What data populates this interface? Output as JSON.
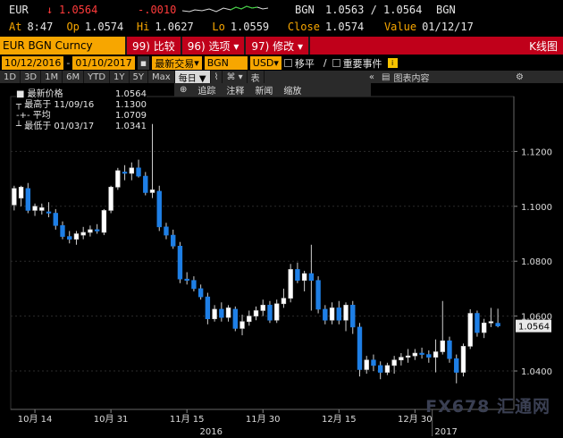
{
  "header": {
    "ticker": "EUR",
    "arrow": "↓",
    "last": "1.0564",
    "change": "-.0010",
    "source": "BGN",
    "bid_ask": "1.0563 / 1.0564",
    "source2": "BGN",
    "at_label": "At",
    "at_time": "8:47",
    "op_label": "Op",
    "op_val": "1.0574",
    "hi_label": "Hi",
    "hi_val": "1.0627",
    "lo_label": "Lo",
    "lo_val": "1.0559",
    "close_label": "Close",
    "close_val": "1.0574",
    "value_label": "Value",
    "value_date": "01/12/17"
  },
  "toolbar": {
    "security": "EUR BGN Curncy",
    "compare": "99) 比较",
    "options": "96) 选项 ▾",
    "modify": "97) 修改 ▾",
    "chart_type": "K线图"
  },
  "controls": {
    "start_date": "10/12/2016",
    "end_date": "01/10/2017",
    "trading": "最新交易",
    "source": "BGN",
    "currency": "USD",
    "move": "移平",
    "events": "重要事件",
    "info_icon": "i"
  },
  "periods": [
    "1D",
    "3D",
    "1M",
    "6M",
    "YTD",
    "1Y",
    "5Y",
    "Max"
  ],
  "active_period": "每日 ▼",
  "period_extra": [
    "表"
  ],
  "chart_content_label": "图表内容",
  "chart_tools": [
    "追踪",
    "注释",
    "新闻",
    "缩放"
  ],
  "legend": [
    {
      "label": "最新价格",
      "value": "1.0564"
    },
    {
      "label": "最高于 11/09/16",
      "value": "1.1300"
    },
    {
      "label": "平均",
      "value": "1.0709"
    },
    {
      "label": "最低于 01/03/17",
      "value": "1.0341"
    }
  ],
  "last_tag": "1.0564",
  "watermark": "FX678 汇通网",
  "chart_data": {
    "type": "candlestick",
    "yticks": [
      1.04,
      1.06,
      1.08,
      1.1,
      1.12
    ],
    "ytick_labels": [
      "1.0400",
      "1.0600",
      "1.0800",
      "1.1000",
      "1.1200"
    ],
    "ylim": [
      1.026,
      1.14
    ],
    "xtick_labels": [
      "10月 14",
      "10月 31",
      "11月 15",
      "11月 30",
      "12月 15",
      "12月 30"
    ],
    "year_labels": [
      "2016",
      "2017"
    ],
    "candles": [
      {
        "o": 1.1005,
        "h": 1.1075,
        "l": 1.0985,
        "c": 1.1065
      },
      {
        "o": 1.103,
        "h": 1.1075,
        "l": 1.1,
        "c": 1.107
      },
      {
        "o": 1.1065,
        "h": 1.1085,
        "l": 1.0975,
        "c": 1.0985
      },
      {
        "o": 1.0985,
        "h": 1.101,
        "l": 1.0965,
        "c": 1.1
      },
      {
        "o": 1.0985,
        "h": 1.101,
        "l": 1.097,
        "c": 1.0995
      },
      {
        "o": 1.098,
        "h": 1.1015,
        "l": 1.096,
        "c": 1.0975
      },
      {
        "o": 1.0975,
        "h": 1.099,
        "l": 1.0915,
        "c": 1.093
      },
      {
        "o": 1.093,
        "h": 1.0945,
        "l": 1.088,
        "c": 1.089
      },
      {
        "o": 1.089,
        "h": 1.091,
        "l": 1.0865,
        "c": 1.088
      },
      {
        "o": 1.088,
        "h": 1.091,
        "l": 1.086,
        "c": 1.09
      },
      {
        "o": 1.0895,
        "h": 1.0925,
        "l": 1.088,
        "c": 1.0905
      },
      {
        "o": 1.0905,
        "h": 1.093,
        "l": 1.089,
        "c": 1.0915
      },
      {
        "o": 1.0915,
        "h": 1.0935,
        "l": 1.09,
        "c": 1.091
      },
      {
        "o": 1.0905,
        "h": 1.099,
        "l": 1.0895,
        "c": 1.0985
      },
      {
        "o": 1.0985,
        "h": 1.1075,
        "l": 1.0975,
        "c": 1.107
      },
      {
        "o": 1.107,
        "h": 1.114,
        "l": 1.106,
        "c": 1.113
      },
      {
        "o": 1.1125,
        "h": 1.115,
        "l": 1.1095,
        "c": 1.112
      },
      {
        "o": 1.112,
        "h": 1.116,
        "l": 1.1095,
        "c": 1.114
      },
      {
        "o": 1.114,
        "h": 1.117,
        "l": 1.1105,
        "c": 1.111
      },
      {
        "o": 1.111,
        "h": 1.1125,
        "l": 1.104,
        "c": 1.105
      },
      {
        "o": 1.105,
        "h": 1.13,
        "l": 1.103,
        "c": 1.106
      },
      {
        "o": 1.1055,
        "h": 1.1075,
        "l": 1.091,
        "c": 1.0925
      },
      {
        "o": 1.0925,
        "h": 1.094,
        "l": 1.088,
        "c": 1.0895
      },
      {
        "o": 1.0895,
        "h": 1.0915,
        "l": 1.0845,
        "c": 1.0855
      },
      {
        "o": 1.0855,
        "h": 1.087,
        "l": 1.072,
        "c": 1.0735
      },
      {
        "o": 1.0735,
        "h": 1.076,
        "l": 1.0715,
        "c": 1.073
      },
      {
        "o": 1.073,
        "h": 1.0745,
        "l": 1.069,
        "c": 1.07
      },
      {
        "o": 1.07,
        "h": 1.0715,
        "l": 1.066,
        "c": 1.067
      },
      {
        "o": 1.067,
        "h": 1.0685,
        "l": 1.057,
        "c": 1.059
      },
      {
        "o": 1.059,
        "h": 1.064,
        "l": 1.058,
        "c": 1.0625
      },
      {
        "o": 1.0625,
        "h": 1.065,
        "l": 1.058,
        "c": 1.0595
      },
      {
        "o": 1.0595,
        "h": 1.064,
        "l": 1.058,
        "c": 1.063
      },
      {
        "o": 1.0625,
        "h": 1.0635,
        "l": 1.0545,
        "c": 1.0555
      },
      {
        "o": 1.0555,
        "h": 1.0605,
        "l": 1.053,
        "c": 1.058
      },
      {
        "o": 1.058,
        "h": 1.062,
        "l": 1.0565,
        "c": 1.06
      },
      {
        "o": 1.06,
        "h": 1.0635,
        "l": 1.0585,
        "c": 1.062
      },
      {
        "o": 1.062,
        "h": 1.066,
        "l": 1.06,
        "c": 1.064
      },
      {
        "o": 1.064,
        "h": 1.0655,
        "l": 1.0575,
        "c": 1.0585
      },
      {
        "o": 1.0585,
        "h": 1.066,
        "l": 1.0575,
        "c": 1.0645
      },
      {
        "o": 1.0645,
        "h": 1.07,
        "l": 1.063,
        "c": 1.0665
      },
      {
        "o": 1.0665,
        "h": 1.079,
        "l": 1.065,
        "c": 1.077
      },
      {
        "o": 1.077,
        "h": 1.0795,
        "l": 1.072,
        "c": 1.073
      },
      {
        "o": 1.073,
        "h": 1.0765,
        "l": 1.069,
        "c": 1.0755
      },
      {
        "o": 1.0755,
        "h": 1.086,
        "l": 1.062,
        "c": 1.073
      },
      {
        "o": 1.073,
        "h": 1.0745,
        "l": 1.061,
        "c": 1.0625
      },
      {
        "o": 1.0625,
        "h": 1.064,
        "l": 1.057,
        "c": 1.0585
      },
      {
        "o": 1.0585,
        "h": 1.065,
        "l": 1.057,
        "c": 1.063
      },
      {
        "o": 1.063,
        "h": 1.0655,
        "l": 1.057,
        "c": 1.0585
      },
      {
        "o": 1.0585,
        "h": 1.065,
        "l": 1.0545,
        "c": 1.064
      },
      {
        "o": 1.064,
        "h": 1.0655,
        "l": 1.0535,
        "c": 1.056
      },
      {
        "o": 1.056,
        "h": 1.0575,
        "l": 1.038,
        "c": 1.0405
      },
      {
        "o": 1.0405,
        "h": 1.0455,
        "l": 1.039,
        "c": 1.044
      },
      {
        "o": 1.044,
        "h": 1.046,
        "l": 1.04,
        "c": 1.042
      },
      {
        "o": 1.042,
        "h": 1.0435,
        "l": 1.037,
        "c": 1.0395
      },
      {
        "o": 1.0395,
        "h": 1.043,
        "l": 1.0385,
        "c": 1.042
      },
      {
        "o": 1.042,
        "h": 1.0455,
        "l": 1.039,
        "c": 1.044
      },
      {
        "o": 1.044,
        "h": 1.0465,
        "l": 1.042,
        "c": 1.045
      },
      {
        "o": 1.045,
        "h": 1.048,
        "l": 1.043,
        "c": 1.0455
      },
      {
        "o": 1.0455,
        "h": 1.048,
        "l": 1.044,
        "c": 1.0465
      },
      {
        "o": 1.0465,
        "h": 1.0485,
        "l": 1.0445,
        "c": 1.046
      },
      {
        "o": 1.046,
        "h": 1.0475,
        "l": 1.043,
        "c": 1.045
      },
      {
        "o": 1.045,
        "h": 1.0515,
        "l": 1.0395,
        "c": 1.047
      },
      {
        "o": 1.047,
        "h": 1.0655,
        "l": 1.046,
        "c": 1.051
      },
      {
        "o": 1.051,
        "h": 1.0525,
        "l": 1.043,
        "c": 1.0445
      },
      {
        "o": 1.0445,
        "h": 1.046,
        "l": 1.0355,
        "c": 1.0395
      },
      {
        "o": 1.0395,
        "h": 1.05,
        "l": 1.038,
        "c": 1.049
      },
      {
        "o": 1.049,
        "h": 1.0625,
        "l": 1.048,
        "c": 1.061
      },
      {
        "o": 1.061,
        "h": 1.062,
        "l": 1.0525,
        "c": 1.054
      },
      {
        "o": 1.054,
        "h": 1.059,
        "l": 1.052,
        "c": 1.0575
      },
      {
        "o": 1.0575,
        "h": 1.063,
        "l": 1.056,
        "c": 1.058
      },
      {
        "o": 1.0574,
        "h": 1.0627,
        "l": 1.0559,
        "c": 1.0564
      }
    ]
  }
}
